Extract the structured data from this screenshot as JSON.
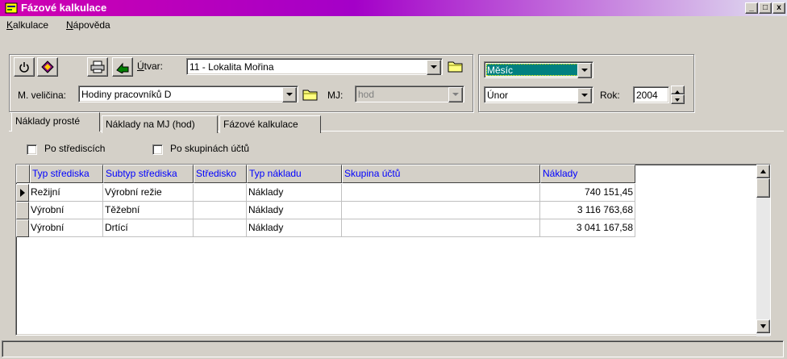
{
  "window": {
    "title": "Fázové kalkulace"
  },
  "menu": {
    "items": [
      {
        "label_u": "K",
        "label_rest": "alkulace"
      },
      {
        "label_u": "N",
        "label_rest": "ápověda"
      }
    ]
  },
  "toolbar": {
    "utvar_label_u": "Ú",
    "utvar_label_rest": "tvar:",
    "utvar_value": "11 - Lokalita Mořina",
    "mveliciny_label": "M. veličina:",
    "mveliciny_value": "Hodiny pracovníků D",
    "mj_label": "MJ:",
    "mj_value": "hod"
  },
  "period": {
    "type_value": "Měsíc",
    "month_value": "Únor",
    "year_label": "Rok:",
    "year_value": "2004"
  },
  "tabs": [
    {
      "label": "Náklady prosté"
    },
    {
      "label": "Náklady na MJ (hod)"
    },
    {
      "label": "Fázové kalkulace"
    }
  ],
  "filters": {
    "po_strediscich": "Po střediscích",
    "po_skupinach": "Po skupinách účtů"
  },
  "grid": {
    "columns": [
      "Typ střediska",
      "Subtyp střediska",
      "Středisko",
      "Typ nákladu",
      "Skupina účtů",
      "Náklady"
    ],
    "rows": [
      [
        "Režijní",
        "Výrobní režie",
        "",
        "Náklady",
        "",
        "740 151,45"
      ],
      [
        "Výrobní",
        "Těžební",
        "",
        "Náklady",
        "",
        "3 116 763,68"
      ],
      [
        "Výrobní",
        "Drtící",
        "",
        "Náklady",
        "",
        "3 041 167,58"
      ]
    ]
  },
  "icons": [
    "app-icon",
    "power-icon",
    "book-icon",
    "printer-icon",
    "export-arrow-icon",
    "folder-icon",
    "spin-up-icon",
    "spin-down-icon"
  ],
  "colors": {
    "title_start": "#d000b0",
    "title_mid": "#a400c8",
    "header_text": "#0000ff",
    "selected_period_bg": "#008080"
  }
}
